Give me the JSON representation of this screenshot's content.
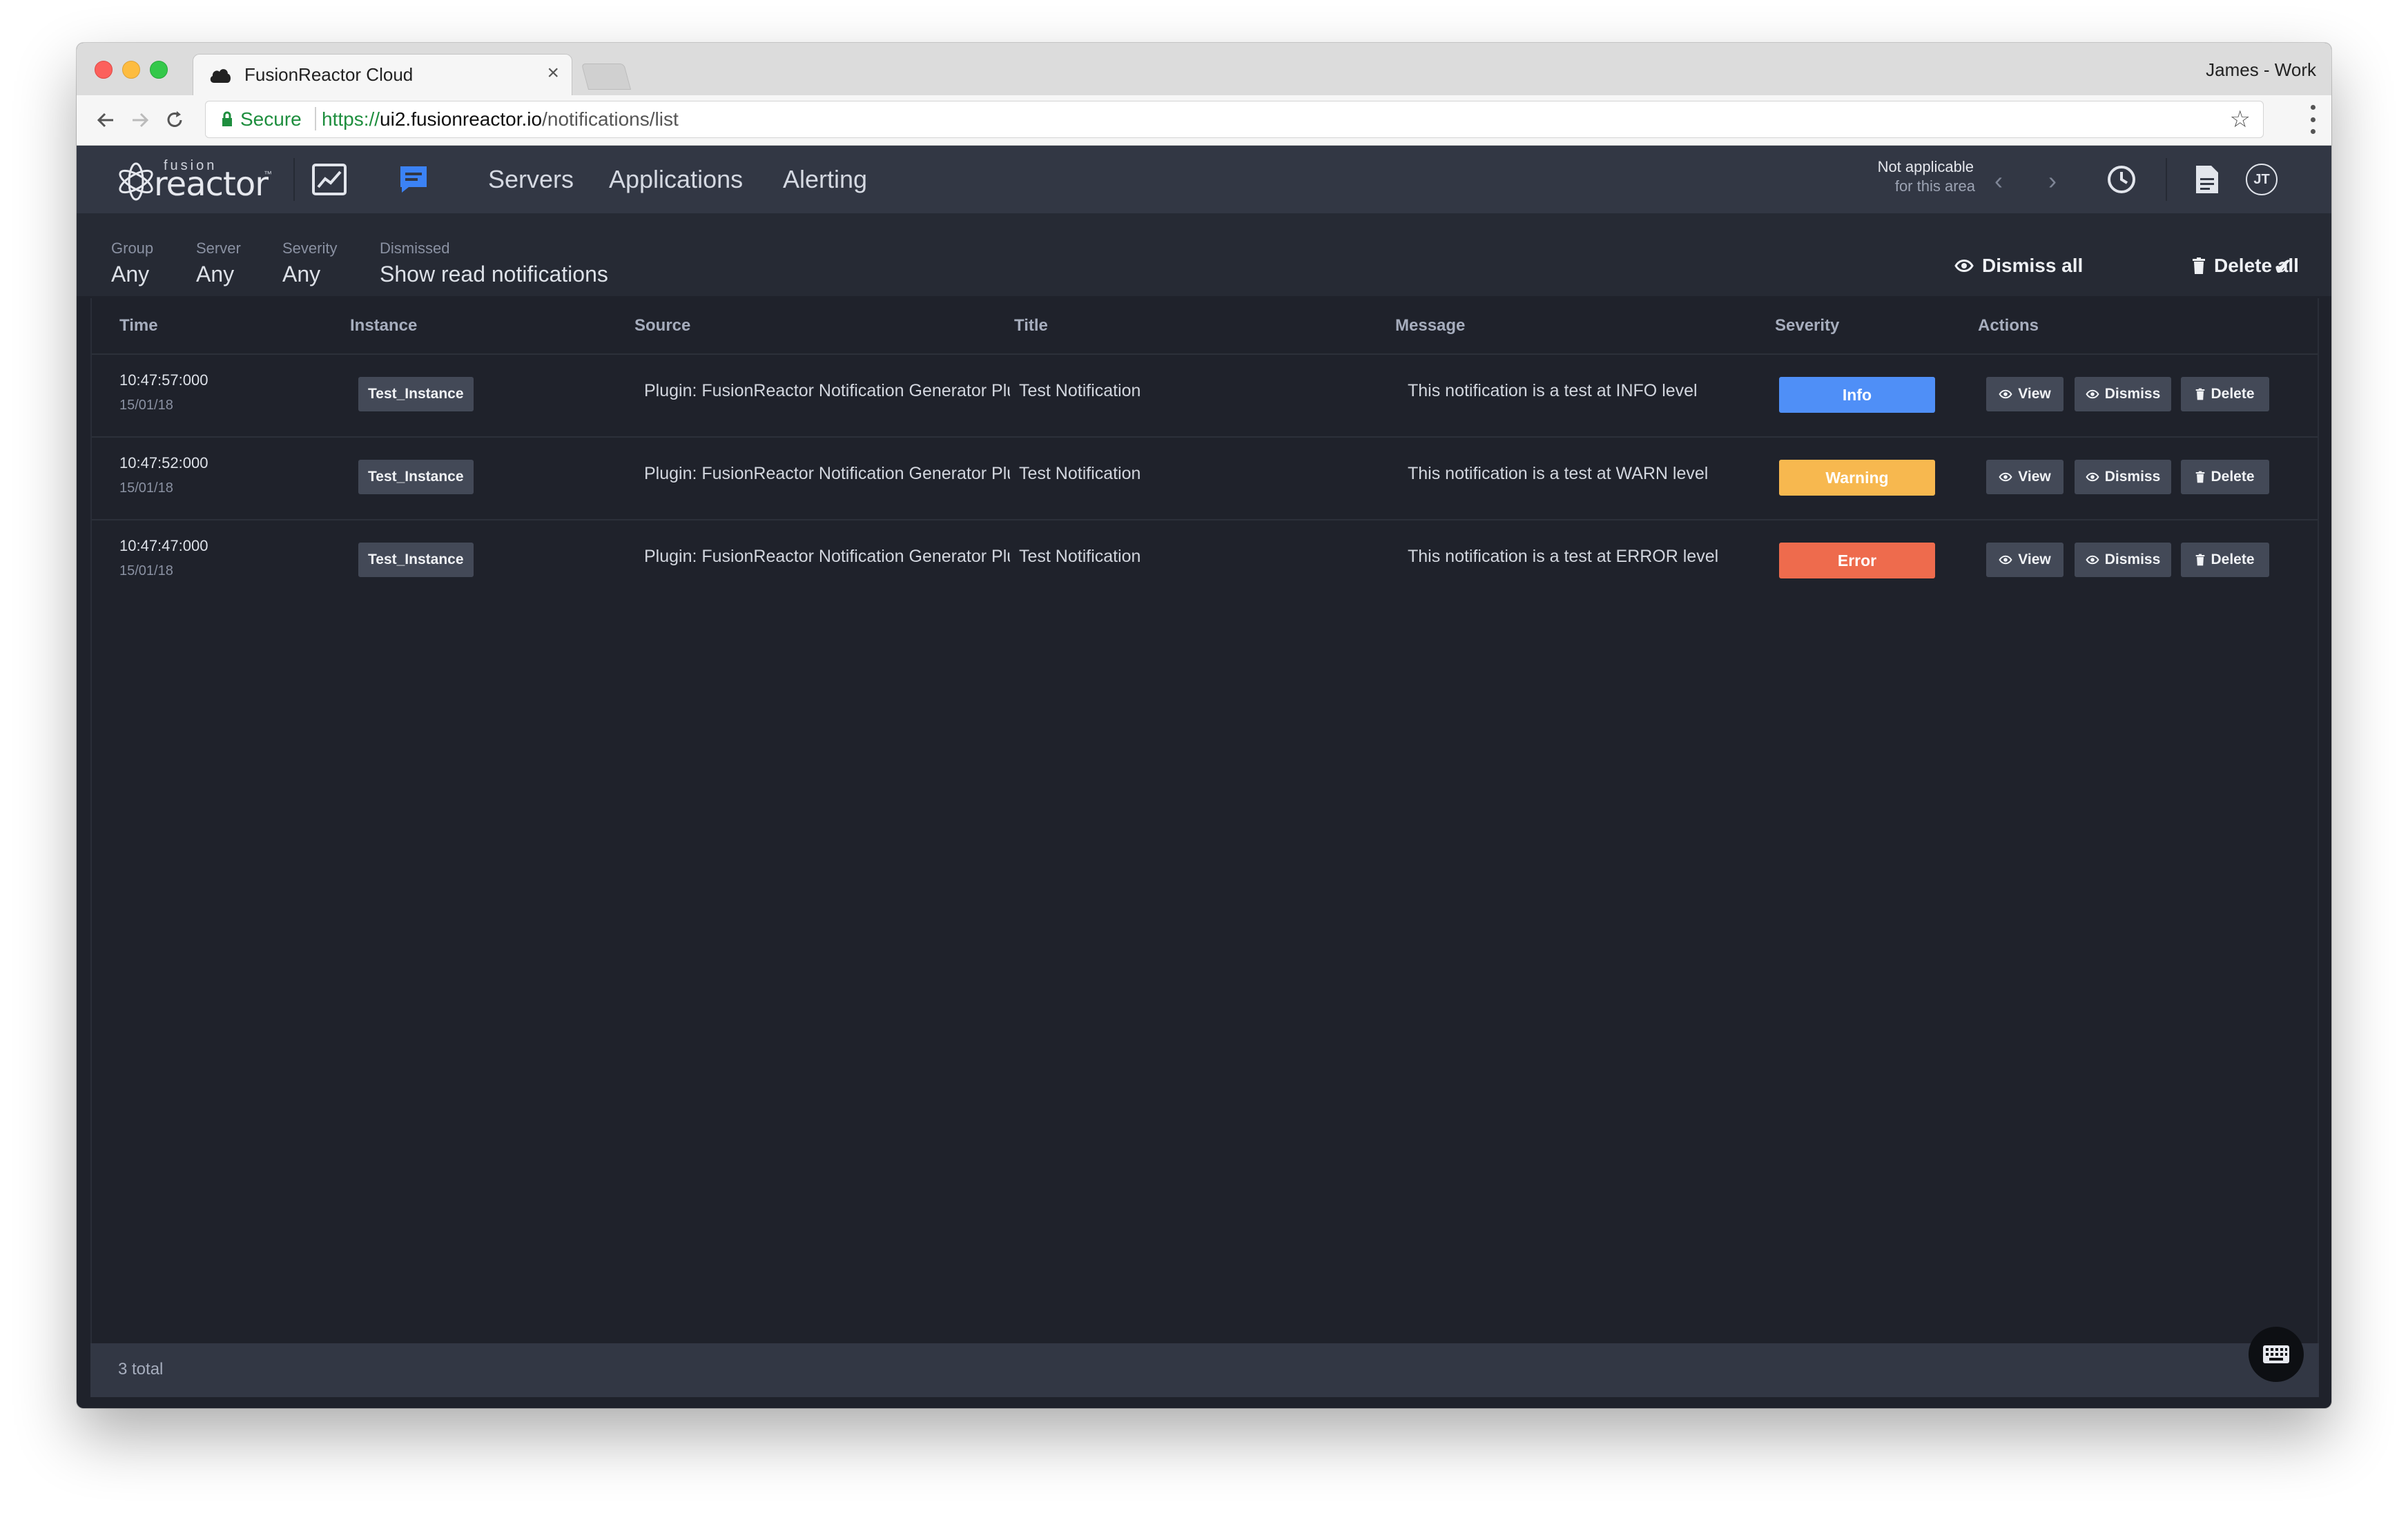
{
  "browser": {
    "tab_title": "FusionReactor Cloud",
    "tab_close": "×",
    "profile": "James - Work",
    "secure_label": "Secure",
    "url_proto": "https://",
    "url_host": "ui2.fusionreactor.io",
    "url_path": "/notifications/list"
  },
  "app": {
    "logo_small": "fusion",
    "logo_main": "reactor",
    "logo_tm": "™",
    "nav": [
      "Servers",
      "Applications",
      "Alerting"
    ],
    "context_line1": "Not applicable",
    "context_line2": "for this area",
    "avatar_initials": "JT",
    "accent_color": "#3b82f6"
  },
  "filters": [
    {
      "label": "Group",
      "value": "Any"
    },
    {
      "label": "Server",
      "value": "Any"
    },
    {
      "label": "Severity",
      "value": "Any"
    },
    {
      "label": "Dismissed",
      "value": "Show read notifications"
    }
  ],
  "actions": {
    "dismiss_all": "Dismiss all",
    "delete_all": "Delete all"
  },
  "table": {
    "columns": [
      "Time",
      "Instance",
      "Source",
      "Title",
      "Message",
      "Severity",
      "Actions"
    ],
    "rows": [
      {
        "time": "10:47:57:000",
        "date": "15/01/18",
        "instance": "Test_Instance",
        "source": "Plugin: FusionReactor Notification Generator Plu",
        "title": "Test Notification",
        "message": "This notification is a test at INFO level",
        "severity": "Info",
        "severity_color": "#4f8ff7"
      },
      {
        "time": "10:47:52:000",
        "date": "15/01/18",
        "instance": "Test_Instance",
        "source": "Plugin: FusionReactor Notification Generator Plu",
        "title": "Test Notification",
        "message": "This notification is a test at WARN level",
        "severity": "Warning",
        "severity_color": "#f7b84f"
      },
      {
        "time": "10:47:47:000",
        "date": "15/01/18",
        "instance": "Test_Instance",
        "source": "Plugin: FusionReactor Notification Generator Plu",
        "title": "Test Notification",
        "message": "This notification is a test at ERROR level",
        "severity": "Error",
        "severity_color": "#ee6b4d"
      }
    ],
    "row_actions": {
      "view": "View",
      "dismiss": "Dismiss",
      "delete": "Delete"
    }
  },
  "footer": {
    "total": "3 total"
  }
}
